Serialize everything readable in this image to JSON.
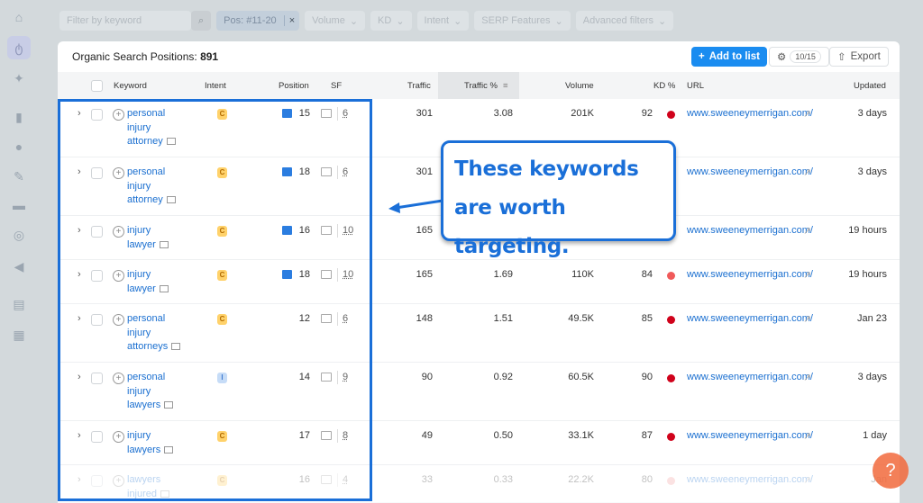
{
  "sidebar": {
    "icons": [
      "home-icon",
      "positions-icon",
      "sparkle-icon",
      "bar-chart-icon",
      "location-icon",
      "edit-icon",
      "message-icon",
      "target-icon",
      "megaphone-icon",
      "document-icon",
      "apps-icon"
    ]
  },
  "filters": {
    "keyword_placeholder": "Filter by keyword",
    "active": "Pos: #11-20",
    "remove": "×",
    "items": [
      "Volume",
      "KD",
      "Intent",
      "SERP Features",
      "Advanced filters"
    ]
  },
  "card": {
    "title": "Organic Search Positions:",
    "count": "891",
    "add_label": "Add to list",
    "columns_count": "10/15",
    "export_label": "Export"
  },
  "columns": [
    "Keyword",
    "Intent",
    "Position",
    "SF",
    "Traffic",
    "Traffic %",
    "Volume",
    "KD %",
    "URL",
    "Updated"
  ],
  "rows": [
    {
      "keyword": "personal injury attorney",
      "intent": "C",
      "position": "15",
      "sf": "6",
      "traffic": "301",
      "traffic_pct": "3.08",
      "volume": "201K",
      "kd": "92",
      "kd_color": "#d0021b",
      "url": "www.sweeneymerrigan.com/",
      "updated": "3 days",
      "img": true
    },
    {
      "keyword": "personal injury attorney",
      "intent": "C",
      "position": "18",
      "sf": "6",
      "traffic": "301",
      "traffic_pct": "",
      "volume": "",
      "kd": "",
      "kd_color": "",
      "url": "www.sweeneymerrigan.com/",
      "updated": "3 days",
      "img": true
    },
    {
      "keyword": "injury lawyer",
      "intent": "C",
      "position": "16",
      "sf": "10",
      "traffic": "165",
      "traffic_pct": "",
      "volume": "",
      "kd": "",
      "kd_color": "",
      "url": "www.sweeneymerrigan.com/",
      "updated": "19 hours",
      "img": true
    },
    {
      "keyword": "injury lawyer",
      "intent": "C",
      "position": "18",
      "sf": "10",
      "traffic": "165",
      "traffic_pct": "1.69",
      "volume": "110K",
      "kd": "84",
      "kd_color": "#f05a5a",
      "url": "www.sweeneymerrigan.com/",
      "updated": "19 hours",
      "img": true
    },
    {
      "keyword": "personal injury attorneys",
      "intent": "C",
      "position": "12",
      "sf": "6",
      "traffic": "148",
      "traffic_pct": "1.51",
      "volume": "49.5K",
      "kd": "85",
      "kd_color": "#d0021b",
      "url": "www.sweeneymerrigan.com/",
      "updated": "Jan 23",
      "img": false
    },
    {
      "keyword": "personal injury lawyers",
      "intent": "I",
      "position": "14",
      "sf": "9",
      "traffic": "90",
      "traffic_pct": "0.92",
      "volume": "60.5K",
      "kd": "90",
      "kd_color": "#d0021b",
      "url": "www.sweeneymerrigan.com/",
      "updated": "3 days",
      "img": false
    },
    {
      "keyword": "injury lawyers",
      "intent": "C",
      "position": "17",
      "sf": "8",
      "traffic": "49",
      "traffic_pct": "0.50",
      "volume": "33.1K",
      "kd": "87",
      "kd_color": "#d0021b",
      "url": "www.sweeneymerrigan.com/",
      "updated": "1 day",
      "img": false
    },
    {
      "keyword": "lawyers injured",
      "intent": "C",
      "position": "16",
      "sf": "4",
      "traffic": "33",
      "traffic_pct": "0.33",
      "volume": "22.2K",
      "kd": "80",
      "kd_color": "#f5a0a0",
      "url": "www.sweeneymerrigan.com/",
      "updated": "Jan",
      "img": false
    }
  ],
  "callout": {
    "text": "These keywords are worth targeting."
  },
  "help": {
    "label": "?"
  }
}
